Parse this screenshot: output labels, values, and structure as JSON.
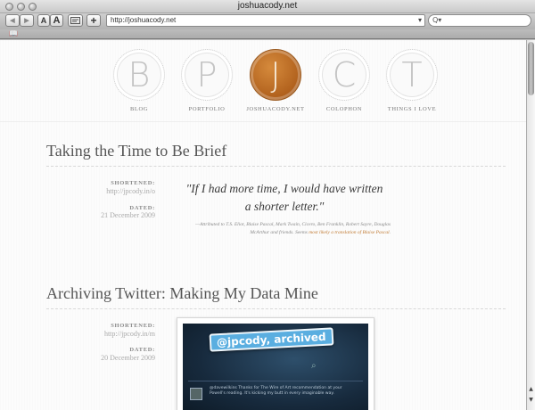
{
  "window": {
    "title": "joshuacody.net",
    "url": "http://joshuacody.net",
    "search_placeholder": "Q▾",
    "buttons": {
      "back": "◀",
      "forward": "▶",
      "text_smaller": "A",
      "text_bigger": "A",
      "add": "+"
    }
  },
  "nav": {
    "items": [
      {
        "letter": "B",
        "label": "BLOG"
      },
      {
        "letter": "P",
        "label": "PORTFOLIO"
      },
      {
        "letter": "J",
        "label": "JOSHUACODY.NET"
      },
      {
        "letter": "C",
        "label": "COLOPHON"
      },
      {
        "letter": "T",
        "label": "THINGS I LOVE"
      }
    ],
    "active_index": 2,
    "accent_color": "#b0601c"
  },
  "posts": [
    {
      "title": "Taking the Time to Be Brief",
      "shortened_label": "SHORTENED:",
      "shortened_value": "http://jpcody.in/o",
      "dated_label": "DATED:",
      "dated_value": "21 December 2009",
      "quote_line1": "\"If I had more time, I would have written",
      "quote_line2": "a shorter letter.\"",
      "attribution_line1": "—Attributed to T.S. Eliot, Blaise Pascal, Mark Twain, Cicero, Ben Franklin, Robert Sayre, Douglas",
      "attribution_line2": "McArthur and friends. Seems ",
      "attribution_link": "most likely a translation of Blaise Pascal",
      "attribution_end": "."
    },
    {
      "title": "Archiving Twitter: Making My Data Mine",
      "shortened_label": "SHORTENED:",
      "shortened_value": "http://jpcody.in/m",
      "dated_label": "DATED:",
      "dated_value": "20 December 2009",
      "image_banner": "@jpcody, archived",
      "image_text": "@davewilkins Thanks for The Wire of Art recommendation at your Powell's reading. It's kicking my butt in every imaginable way."
    }
  ]
}
